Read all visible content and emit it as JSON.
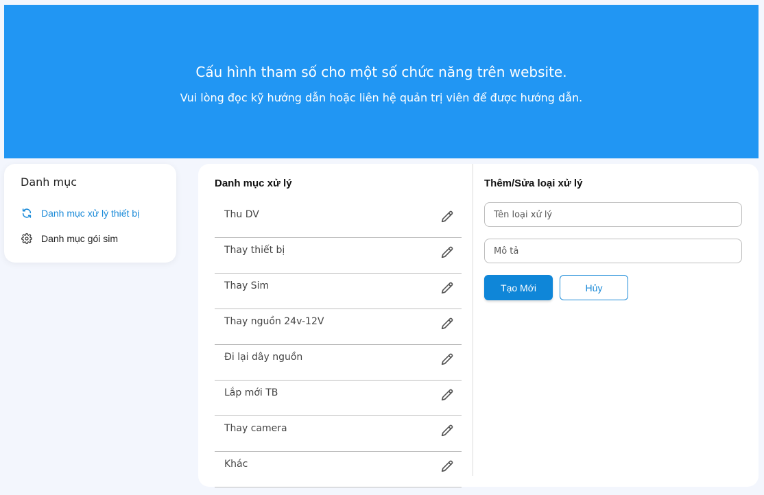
{
  "banner": {
    "title": "Cấu hình tham số cho một số chức năng trên website.",
    "subtitle": "Vui lòng đọc kỹ hướng dẫn hoặc liên hệ quản trị viên để được hướng dẫn."
  },
  "sidebar": {
    "title": "Danh mục",
    "items": [
      {
        "label": "Danh mục xử lý thiết bị",
        "icon": "sync-icon",
        "active": true
      },
      {
        "label": "Danh mục gói sim",
        "icon": "gear-icon",
        "active": false
      }
    ]
  },
  "list_panel": {
    "title": "Danh mục xử lý",
    "items": [
      "Thu DV",
      "Thay thiết bị",
      "Thay Sim",
      "Thay nguồn 24v-12V",
      "Đi lại dây nguồn",
      "Lắp mới TB",
      "Thay camera",
      "Khác"
    ],
    "edit_icon": "pencil-icon"
  },
  "form_panel": {
    "title": "Thêm/Sửa loại xử lý",
    "name_placeholder": "Tên loại xử lý",
    "desc_placeholder": "Mô tả",
    "create_label": "Tạo Mới",
    "cancel_label": "Hủy"
  },
  "colors": {
    "banner": "#2196f3",
    "accent": "#1a8ad8",
    "primary_button": "#0f86d8",
    "background": "#f3f6fd"
  }
}
